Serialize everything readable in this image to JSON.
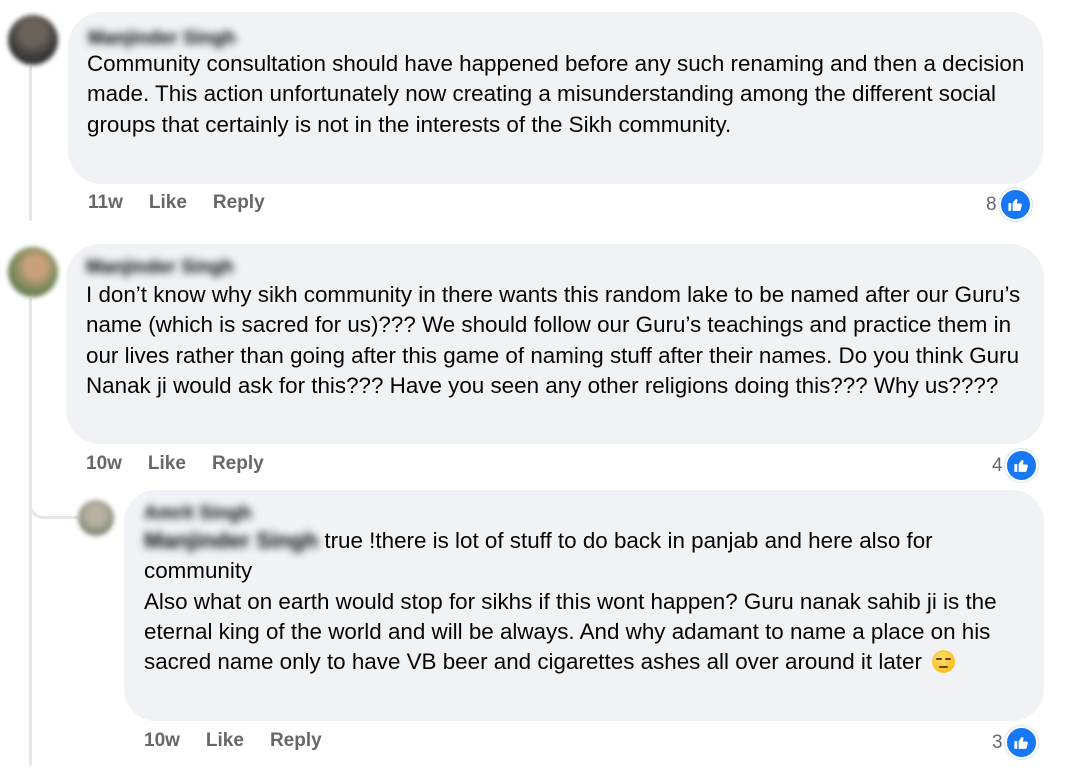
{
  "comments": [
    {
      "author": "Manjinder Singh",
      "text": "Community consultation should have happened before any such renaming and then a decision made. This action unfortunately now creating a misunderstanding among the different social groups that certainly is not in the interests of the Sikh community.",
      "time": "11w",
      "like_label": "Like",
      "reply_label": "Reply",
      "reaction_count": "8",
      "reaction_icon": "thumbs-up-icon",
      "avatar_colors": [
        "#3b3a38",
        "#6a6258"
      ]
    },
    {
      "author": "Manjinder Singh",
      "text": "I don’t know why sikh community in there wants this random lake to be named after our Guru’s name (which is sacred for us)??? We should follow our Guru’s teachings and practice them in our lives rather than going after this game of naming stuff after their names. Do you think Guru Nanak ji would ask for this??? Have you seen any other religions doing this??? Why us????",
      "time": "10w",
      "like_label": "Like",
      "reply_label": "Reply",
      "reaction_count": "4",
      "reaction_icon": "thumbs-up-icon",
      "avatar_colors": [
        "#7a8a5c",
        "#c9a07a"
      ]
    },
    {
      "author": "Amrit Singh",
      "mention": "Manjinder Singh",
      "text_line1": " true !there is lot of stuff to do back in panjab and here also for community",
      "text_line2": "Also what on earth would stop for sikhs if this wont happen? Guru nanak sahib ji is the eternal king of the world and will be always. And why adamant to name a place on his sacred name only to have VB beer and cigarettes ashes all over around it later ",
      "emoji": "unamused-face-icon",
      "time": "10w",
      "like_label": "Like",
      "reply_label": "Reply",
      "reaction_count": "3",
      "reaction_icon": "thumbs-up-icon",
      "avatar_colors": [
        "#8a8f7e",
        "#b8b2a2"
      ]
    }
  ],
  "colors": {
    "bubble": "#f0f2f5",
    "text": "#050505",
    "meta": "#65676b",
    "like_blue": "#1877f2",
    "thread_line": "#e4e6eb"
  }
}
